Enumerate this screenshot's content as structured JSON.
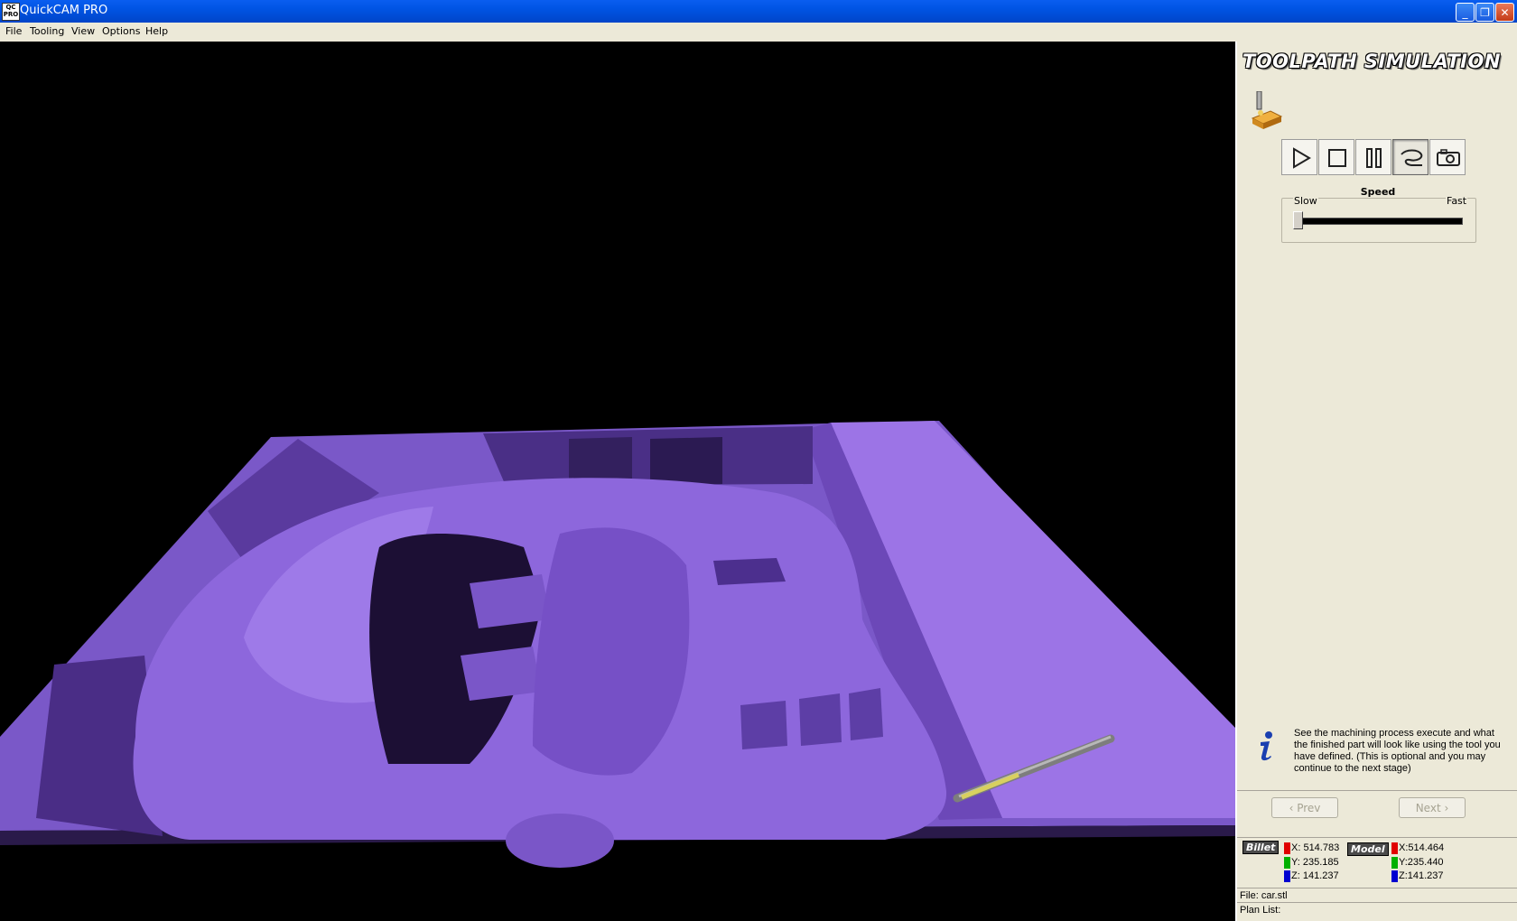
{
  "window": {
    "icon_text": "QC PRO",
    "title": "QuickCAM PRO",
    "minimize": "_",
    "restore": "❐",
    "close": "✕"
  },
  "menu": {
    "items": [
      "File",
      "Tooling",
      "View",
      "Options",
      "Help"
    ]
  },
  "viewport": {
    "model": "car",
    "background": "#000000",
    "part_color": "#8a62d8"
  },
  "panel": {
    "title": "TOOLPATH SIMULATION",
    "icons": [
      "mill-tool-icon",
      "play-icon",
      "stop-icon",
      "pause-icon",
      "toolpath-icon",
      "camera-icon"
    ],
    "speed": {
      "title": "Speed",
      "slow": "Slow",
      "fast": "Fast",
      "value_fraction": 0.0
    },
    "info": "See the machining process execute and what the finished part will look like using the tool you have defined. (This is optional and you may continue to the next stage)",
    "prev": "‹ Prev",
    "next": "Next ›"
  },
  "coords": {
    "billet": {
      "label": "Billet",
      "x": "X: 514.783",
      "y": "Y: 235.185",
      "z": "Z: 141.237"
    },
    "model": {
      "label": "Model",
      "x": "X:514.464",
      "y": "Y:235.440",
      "z": "Z:141.237"
    }
  },
  "status": {
    "file": "File: car.stl",
    "plan": "Plan List:"
  }
}
